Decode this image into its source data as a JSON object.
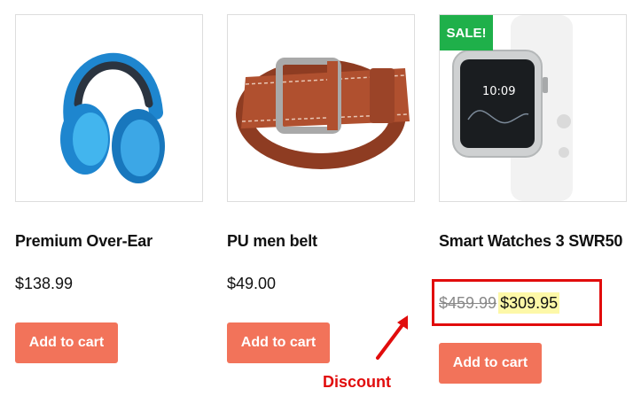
{
  "products": [
    {
      "title": "Premium Over-Ear",
      "price": "$138.99",
      "button_label": "Add to cart",
      "image": "headphones"
    },
    {
      "title": "PU men belt",
      "price": "$49.00",
      "button_label": "Add to cart",
      "image": "belt"
    },
    {
      "title": "Smart Watches 3 SWR50",
      "badge": "SALE!",
      "old_price": "$459.99",
      "price": "$309.95",
      "button_label": "Add to cart",
      "image": "smartwatch",
      "watch_time": "10:09"
    }
  ],
  "annotation": {
    "label": "Discount",
    "color": "#e10c0c"
  },
  "colors": {
    "button": "#f2735a",
    "sale_badge": "#1fb04a",
    "price_highlight": "#fdf8a8"
  }
}
